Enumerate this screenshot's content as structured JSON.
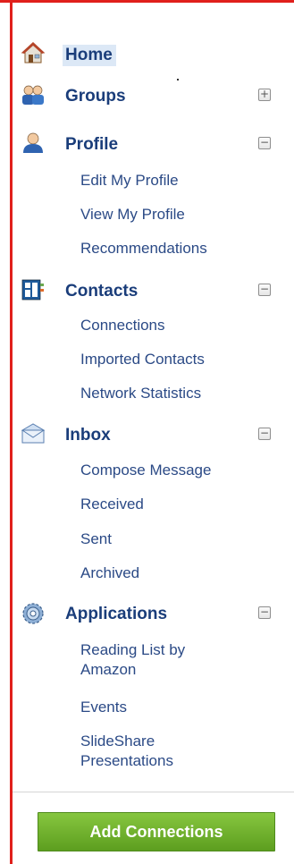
{
  "sidebar": {
    "home": {
      "label": "Home",
      "icon": "home-icon"
    },
    "groups": {
      "label": "Groups",
      "icon": "groups-icon",
      "toggle": "+"
    },
    "profile": {
      "label": "Profile",
      "icon": "profile-icon",
      "toggle": "−",
      "items": [
        "Edit My Profile",
        "View My Profile",
        "Recommendations"
      ]
    },
    "contacts": {
      "label": "Contacts",
      "icon": "contacts-icon",
      "toggle": "−",
      "items": [
        "Connections",
        "Imported Contacts",
        "Network Statistics"
      ]
    },
    "inbox": {
      "label": "Inbox",
      "icon": "inbox-icon",
      "toggle": "−",
      "items": [
        "Compose Message",
        "Received",
        "Sent",
        "Archived"
      ]
    },
    "applications": {
      "label": "Applications",
      "icon": "applications-icon",
      "toggle": "−",
      "items": [
        "Reading List by Amazon",
        "Events",
        "SlideShare Presentations"
      ]
    }
  },
  "add_connections_label": "Add Connections",
  "colors": {
    "frame": "#e0201c",
    "link": "#2b4a86",
    "heading": "#1a3d7a",
    "home_highlight": "#dce8f6",
    "button_green": "#6fb02c"
  }
}
